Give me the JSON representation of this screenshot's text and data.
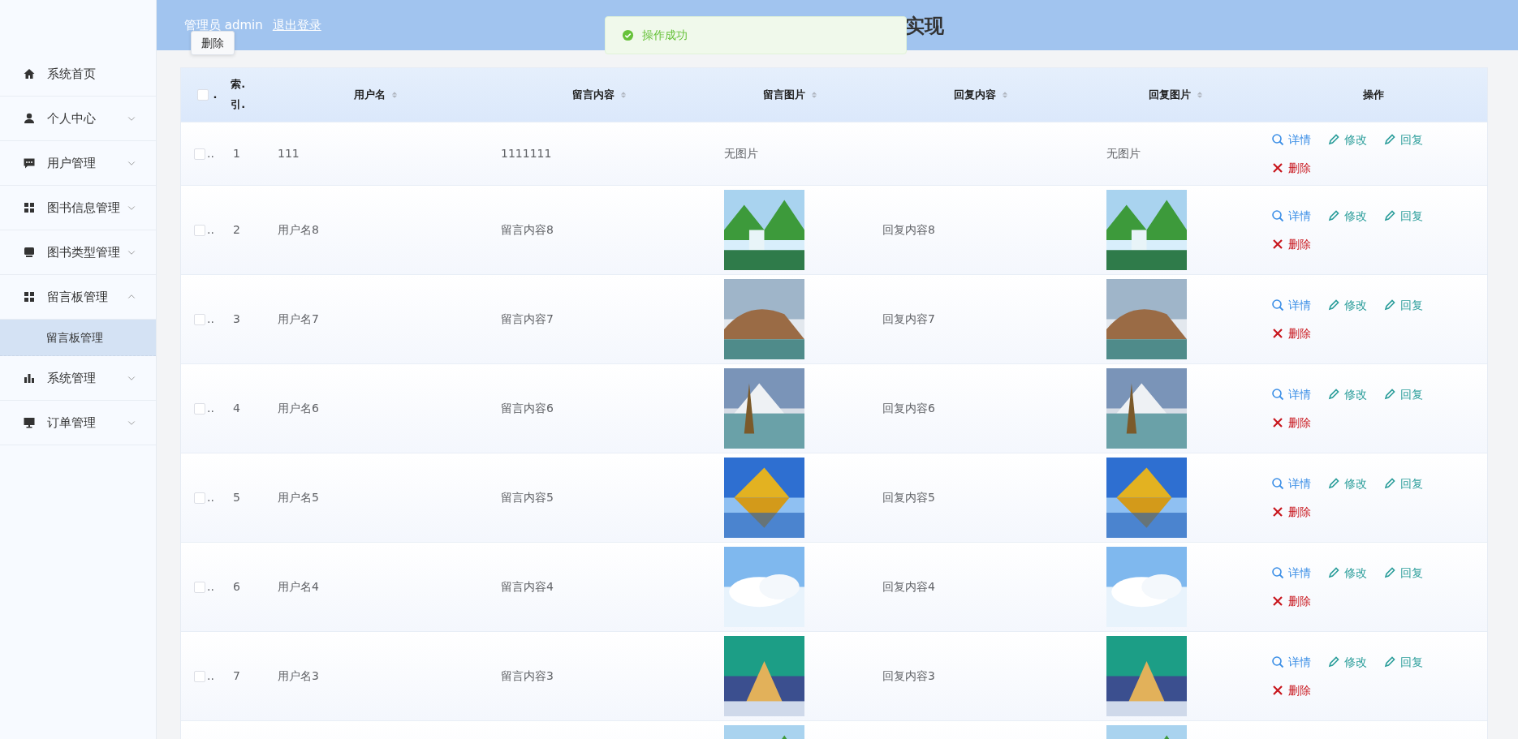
{
  "sidebar": {
    "items": [
      {
        "label": "系统首页"
      },
      {
        "label": "个人中心",
        "expanded": false
      },
      {
        "label": "用户管理",
        "expanded": false
      },
      {
        "label": "图书信息管理",
        "expanded": false
      },
      {
        "label": "图书类型管理",
        "expanded": false
      },
      {
        "label": "留言板管理",
        "expanded": true,
        "children": [
          {
            "label": "留言板管理",
            "selected": true
          }
        ]
      },
      {
        "label": "系统管理",
        "expanded": false
      },
      {
        "label": "订单管理",
        "expanded": false
      }
    ]
  },
  "header": {
    "user": "管理员 admin",
    "logout": "退出登录",
    "title": "实现"
  },
  "popup_button": {
    "label": "删除"
  },
  "toast": {
    "kind": "success",
    "message": "操作成功"
  },
  "table": {
    "select_all": {
      "checked": false,
      "suffix": "."
    },
    "columns": [
      {
        "label": "索.引.",
        "sortable": false
      },
      {
        "label": "用户名",
        "sortable": true
      },
      {
        "label": "留言内容",
        "sortable": true
      },
      {
        "label": "留言图片",
        "sortable": true
      },
      {
        "label": "回复内容",
        "sortable": true
      },
      {
        "label": "回复图片",
        "sortable": true
      },
      {
        "label": "操作",
        "sortable": false
      }
    ],
    "rows": [
      {
        "checked": false,
        "suffix": "..",
        "index": "1",
        "username": "111",
        "content": "1111111",
        "image": {
          "kind": "text",
          "text": "无图片"
        },
        "reply_image": {
          "kind": "text",
          "text": "无图片"
        },
        "actions": [
          {
            "kind": "view",
            "label": "详情"
          },
          {
            "kind": "edit",
            "label": "修改"
          },
          {
            "kind": "reply",
            "label": "回复"
          },
          {
            "kind": "delete",
            "label": "删除"
          }
        ]
      },
      {
        "checked": false,
        "suffix": "..",
        "index": "2",
        "username": "用户名8",
        "content": "留言内容8",
        "image": {
          "kind": "picture"
        },
        "reply": "回复内容8",
        "reply_image": {
          "kind": "picture"
        },
        "actions": [
          {
            "kind": "view",
            "label": "详情"
          },
          {
            "kind": "edit",
            "label": "修改"
          },
          {
            "kind": "reply",
            "label": "回复"
          },
          {
            "kind": "delete",
            "label": "删除"
          }
        ]
      },
      {
        "checked": false,
        "suffix": "..",
        "index": "3",
        "username": "用户名7",
        "content": "留言内容7",
        "image": {
          "kind": "picture"
        },
        "reply": "回复内容7",
        "reply_image": {
          "kind": "picture"
        },
        "actions": [
          {
            "kind": "view",
            "label": "详情"
          },
          {
            "kind": "edit",
            "label": "修改"
          },
          {
            "kind": "reply",
            "label": "回复"
          },
          {
            "kind": "delete",
            "label": "删除"
          }
        ]
      },
      {
        "checked": false,
        "suffix": "..",
        "index": "4",
        "username": "用户名6",
        "content": "留言内容6",
        "image": {
          "kind": "picture"
        },
        "reply": "回复内容6",
        "reply_image": {
          "kind": "picture"
        },
        "actions": [
          {
            "kind": "view",
            "label": "详情"
          },
          {
            "kind": "edit",
            "label": "修改"
          },
          {
            "kind": "reply",
            "label": "回复"
          },
          {
            "kind": "delete",
            "label": "删除"
          }
        ]
      },
      {
        "checked": false,
        "suffix": "..",
        "index": "5",
        "username": "用户名5",
        "content": "留言内容5",
        "image": {
          "kind": "picture"
        },
        "reply": "回复内容5",
        "reply_image": {
          "kind": "picture"
        },
        "actions": [
          {
            "kind": "view",
            "label": "详情"
          },
          {
            "kind": "edit",
            "label": "修改"
          },
          {
            "kind": "reply",
            "label": "回复"
          },
          {
            "kind": "delete",
            "label": "删除"
          }
        ]
      },
      {
        "checked": false,
        "suffix": "..",
        "index": "6",
        "username": "用户名4",
        "content": "留言内容4",
        "image": {
          "kind": "picture"
        },
        "reply": "回复内容4",
        "reply_image": {
          "kind": "picture"
        },
        "actions": [
          {
            "kind": "view",
            "label": "详情"
          },
          {
            "kind": "edit",
            "label": "修改"
          },
          {
            "kind": "reply",
            "label": "回复"
          },
          {
            "kind": "delete",
            "label": "删除"
          }
        ]
      },
      {
        "checked": false,
        "suffix": "..",
        "index": "7",
        "username": "用户名3",
        "content": "留言内容3",
        "image": {
          "kind": "picture"
        },
        "reply": "回复内容3",
        "reply_image": {
          "kind": "picture"
        },
        "actions": [
          {
            "kind": "view",
            "label": "详情"
          },
          {
            "kind": "edit",
            "label": "修改"
          },
          {
            "kind": "reply",
            "label": "回复"
          },
          {
            "kind": "delete",
            "label": "删除"
          }
        ]
      },
      {
        "image": {
          "kind": "picture"
        },
        "reply_image": {
          "kind": "picture"
        }
      }
    ]
  }
}
